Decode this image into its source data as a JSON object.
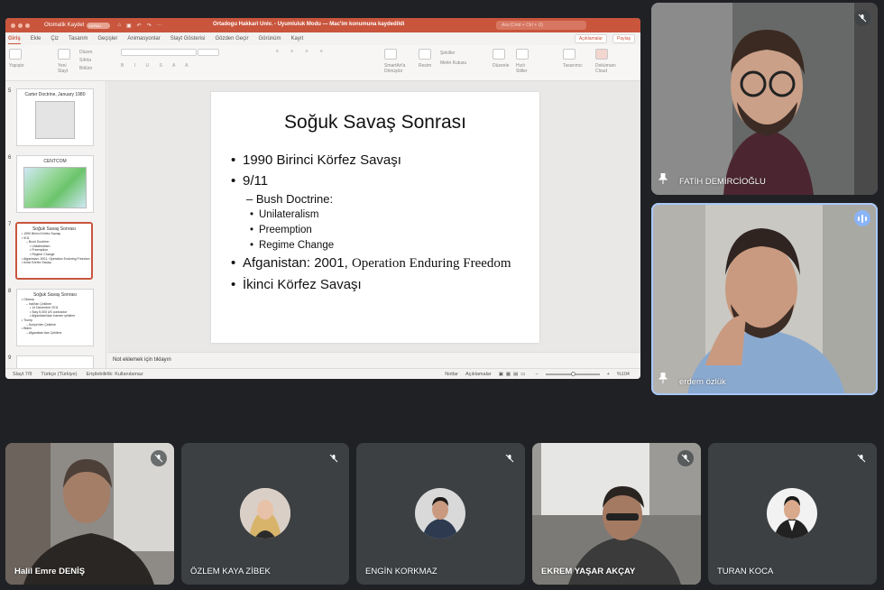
{
  "ppt": {
    "autosave_label": "Otomatik Kaydet",
    "autosave_state": "KAPALI",
    "doc_title": "Ortadogu Hakkari Univ. - Uyumluluk Modu — Mac'im konumuna kaydedildi",
    "search_placeholder": "Ara (Cmd + Ctrl + U)",
    "tabs": [
      "Giriş",
      "Ekle",
      "Çiz",
      "Tasarım",
      "Geçişler",
      "Animasyonlar",
      "Slayt Gösterisi",
      "Gözden Geçir",
      "Görünüm",
      "Kayıt"
    ],
    "comments_label": "Açıklamalar",
    "share_label": "Paylaş",
    "ribbon": {
      "paste": "Yapıştır",
      "new_slide": "Yeni Slayt",
      "layout": "Düzen",
      "reset": "Sıfırla",
      "section": "Bölüm",
      "smartart": "SmartArt'a Dönüştür",
      "picture": "Resim",
      "shapes": "Şekiller",
      "textbox": "Metin Kutusu",
      "arrange": "Düzenle",
      "quick_styles": "Hızlı Stiller",
      "designer": "Tasarımcı",
      "document": "Dokümanı Cloud"
    },
    "thumbnails": [
      {
        "num": "5",
        "title": "Carter Doctrine, January 1980",
        "lines": []
      },
      {
        "num": "6",
        "title": "CENTCOM",
        "lines": []
      },
      {
        "num": "7",
        "title": "Soğuk Savaş Sonrası",
        "lines": [
          "• 1990 Birinci Körfez Savaşı",
          "• 9/11",
          "– Bush Doctrine:",
          "• Unilateralism",
          "• Preemption",
          "• Regime Change",
          "• Afganistan: 2001, Operation Enduring Freedom",
          "• İkinci Körfez Savaşı"
        ]
      },
      {
        "num": "8",
        "title": "Soğuk Savaş Sonrası",
        "lines": [
          "• Obama",
          "– Irak'tan Çekilme",
          "• 14 December 2011",
          "• Stay 5,000 US contractor",
          "• Afganistan'dan kısmen çekilme",
          "• Trump",
          "– Suriye'den Çekilme",
          "• Biden",
          "– Afganistan'dan Çekilme"
        ]
      },
      {
        "num": "9",
        "title": "",
        "lines": []
      }
    ],
    "slide": {
      "title": "Soğuk Savaş Sonrası",
      "b1": "1990 Birinci Körfez Savaşı",
      "b2": "9/11",
      "b2_sub": "– Bush Doctrine:",
      "b2_sub_items": [
        "Unilateralism",
        "Preemption",
        "Regime Change"
      ],
      "b3_plain": "Afganistan: 2001, ",
      "b3_serif": "Operation Enduring Freedom",
      "b4": "İkinci Körfez Savaşı"
    },
    "notes_placeholder": "Not eklemek için tıklayın",
    "status": {
      "slide_counter": "Slayt 7/9",
      "language": "Türkçe (Türkiye)",
      "accessibility": "Erişilebilirlik: Kullanılamaz",
      "notes": "Notlar",
      "comments": "Açıklamalar",
      "zoom": "%104"
    }
  },
  "participants": {
    "fatih": "FATİH DEMİRCİOĞLU",
    "erdem": "erdem özlük",
    "halil": "Halil Emre DENİŞ",
    "ozlem": "ÖZLEM KAYA ZİBEK",
    "engin": "ENGİN KORKMAZ",
    "ekrem": "EKREM YAŞAR AKÇAY",
    "turan": "TURAN KOCA"
  },
  "colors": {
    "ppt_accent": "#c9553d",
    "tile_bg": "#3c4043",
    "speaking_outline": "#a8c7fa"
  }
}
